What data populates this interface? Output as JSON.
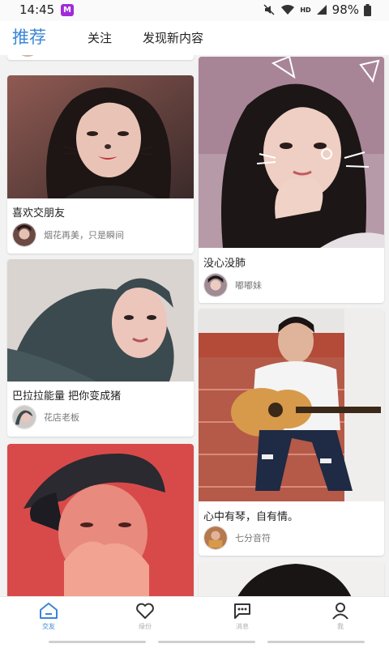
{
  "status_bar": {
    "time": "14:45",
    "app_badge": "M",
    "network": "HD",
    "battery": "98%"
  },
  "tabs": {
    "recommend": "推荐",
    "follow": "关注",
    "discover": "发现新内容"
  },
  "feed": {
    "posts": [
      {
        "caption": "喜欢交朋友",
        "author": "烟花再美，只是瞬间"
      },
      {
        "caption": "没心没肺",
        "author": "嘟嘟妹"
      },
      {
        "caption": "巴拉拉能量 把你变成猪",
        "author": "花店老板"
      },
      {
        "caption": "心中有琴，自有情。",
        "author": "七分音符"
      }
    ]
  },
  "bottom_nav": {
    "friends": "交友",
    "fate": "缘份",
    "messages": "消息",
    "me": "我"
  },
  "colors": {
    "accent": "#3a86d6",
    "nav_inactive": "#b0b0b0"
  }
}
